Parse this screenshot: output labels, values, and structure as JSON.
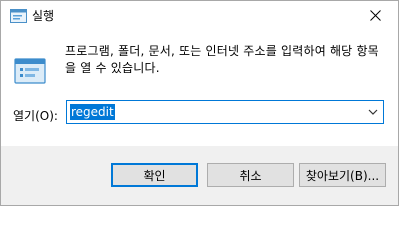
{
  "window": {
    "title": "실행",
    "close_icon": "close-icon"
  },
  "content": {
    "icon": "run-icon",
    "description": "프로그램, 폴더, 문서, 또는 인터넷 주소를 입력하여 해당 항목을 열 수 있습니다.",
    "open_label": "열기(O):",
    "open_value": "regedit"
  },
  "buttons": {
    "ok": "확인",
    "cancel": "취소",
    "browse": "찾아보기(B)..."
  },
  "colors": {
    "accent": "#0078d7",
    "footer_bg": "#f0f0f0",
    "button_bg": "#e1e1e1"
  }
}
